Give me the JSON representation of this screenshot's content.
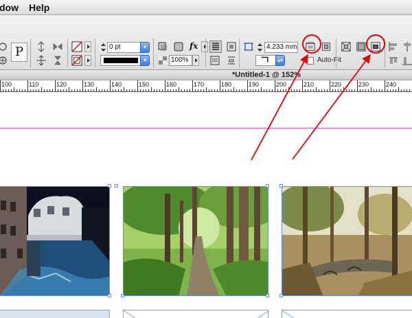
{
  "menu": {
    "items": [
      "dow",
      "Help"
    ]
  },
  "control_panel": {
    "stroke_weight": "0 pt",
    "zoom": "100%",
    "dimension_value": "4.233 mm",
    "auto_fit_label": "Auto-Fit",
    "fx_label": "fx",
    "p_label": "P"
  },
  "document": {
    "title": "*Untitled-1 @ 152%"
  },
  "ruler": {
    "labels": [
      "100",
      "110",
      "120",
      "130",
      "140",
      "150",
      "160",
      "170",
      "180",
      "190",
      "200",
      "210",
      "220",
      "230",
      "240"
    ]
  },
  "colors": {
    "annotation": "#e60000",
    "guide": "#d35fd3",
    "selection": "#5e8ee6"
  },
  "images": [
    {
      "subject": "venice canal bridge"
    },
    {
      "subject": "forest path"
    },
    {
      "subject": "forest stone bridge"
    }
  ]
}
